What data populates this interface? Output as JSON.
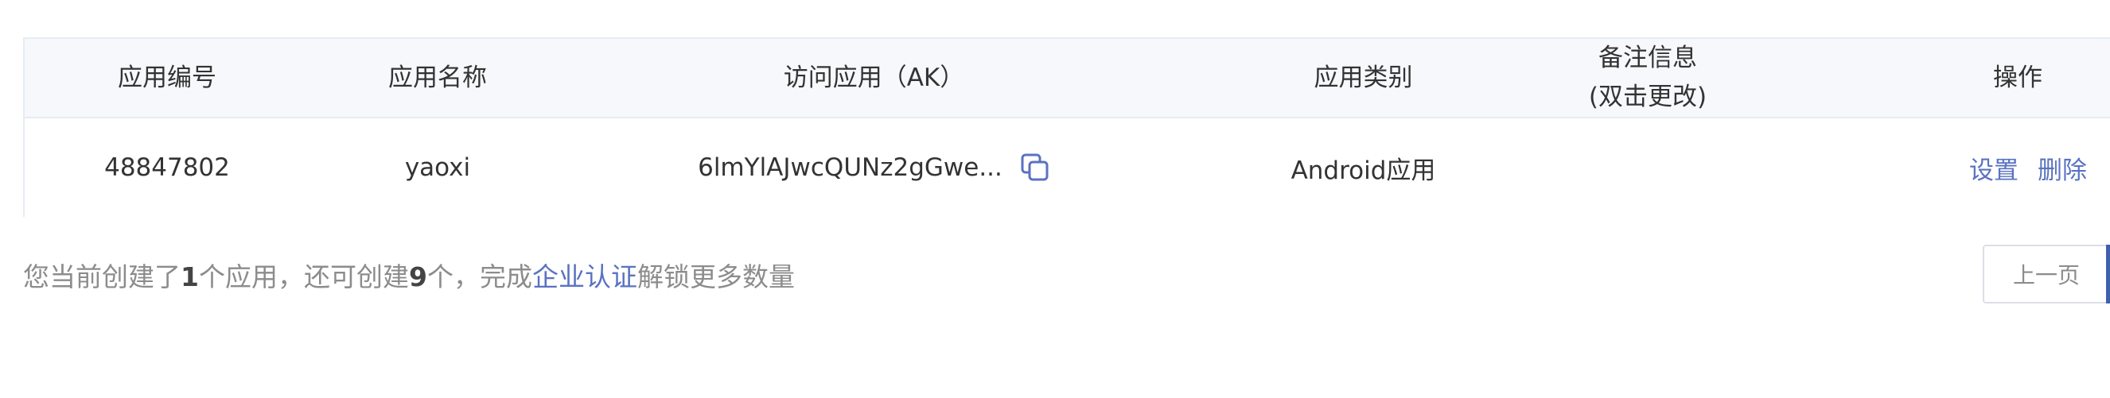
{
  "table": {
    "headers": {
      "app_id": "应用编号",
      "app_name": "应用名称",
      "access_key": "访问应用（AK）",
      "app_type": "应用类别",
      "remark_line1": "备注信息",
      "remark_line2": "(双击更改)",
      "actions": "操作"
    },
    "rows": [
      {
        "app_id": "48847802",
        "app_name": "yaoxi",
        "access_key": "6lmYlAJwcQUNz2gGwe...",
        "app_type": "Android应用",
        "remark": "",
        "settings_label": "设置",
        "delete_label": "删除"
      }
    ]
  },
  "footer": {
    "prefix": "您当前创建了",
    "created_count": "1",
    "middle": "个应用，还可创建",
    "remaining_count": "9",
    "middle2": "个，完成",
    "link_label": "企业认证",
    "suffix": "解锁更多数量"
  },
  "pagination": {
    "prev_label": "上一页"
  },
  "colors": {
    "link": "#5a72c2",
    "header_bg": "#f6f8fb",
    "border": "#e6ecf3",
    "accent": "#3f5fb0"
  },
  "icons": {
    "copy": "copy-icon"
  }
}
